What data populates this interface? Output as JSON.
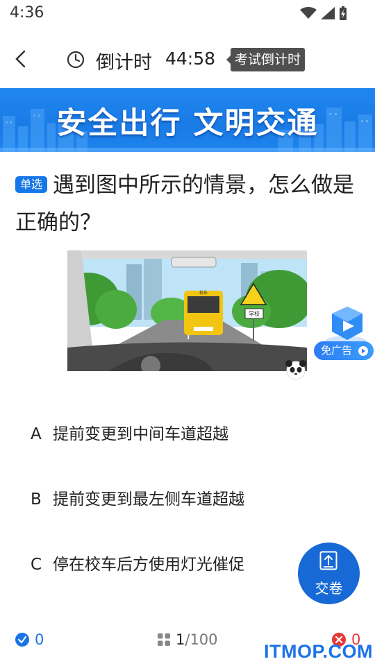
{
  "status": {
    "time": "4:36"
  },
  "header": {
    "countdown_label": "倒计时",
    "countdown_value": "44:58",
    "tooltip": "考试倒计时"
  },
  "banner": {
    "text": "安全出行 文明交通"
  },
  "question": {
    "type_badge": "单选",
    "text": "遇到图中所示的情景，怎么做是正确的？",
    "scene_labels": {
      "bus_sign": "校车",
      "school_sign": "学校"
    }
  },
  "ad": {
    "label": "免广告"
  },
  "options": [
    {
      "letter": "A",
      "text": "提前变更到中间车道超越"
    },
    {
      "letter": "B",
      "text": "提前变更到最左侧车道超越"
    },
    {
      "letter": "C",
      "text": "停在校车后方使用灯光催促"
    }
  ],
  "submit": {
    "label": "交卷"
  },
  "bottom": {
    "correct_count": "0",
    "current": "1",
    "total": "/100",
    "wrong_count": "0"
  },
  "watermark": "ITMOP.COM",
  "colors": {
    "accent": "#1769d6",
    "banner": "#1a7be6",
    "correct": "#1a73e8",
    "wrong": "#e53935"
  }
}
